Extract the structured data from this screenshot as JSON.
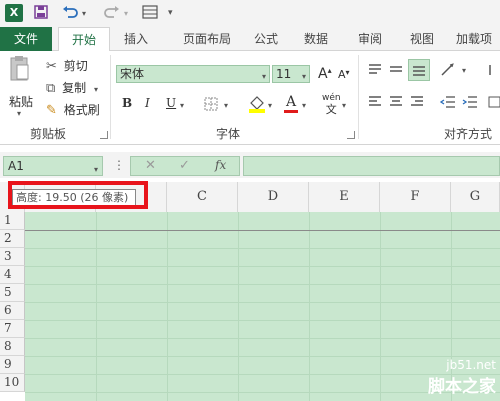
{
  "qat": {
    "excel_badge": "X",
    "save_icon": "save-icon",
    "undo_icon": "undo-icon",
    "redo_icon": "redo-icon",
    "customize_icon": "customize-icon"
  },
  "tabs": [
    {
      "label": "文件"
    },
    {
      "label": "开始"
    },
    {
      "label": "插入"
    },
    {
      "label": "页面布局"
    },
    {
      "label": "公式"
    },
    {
      "label": "数据"
    },
    {
      "label": "审阅"
    },
    {
      "label": "视图"
    },
    {
      "label": "加载项"
    }
  ],
  "ribbon": {
    "clipboard": {
      "paste": "粘贴",
      "cut": "剪切",
      "copy": "复制",
      "format_painter": "格式刷",
      "group_label": "剪贴板"
    },
    "font": {
      "font_name": "宋体",
      "font_size": "11",
      "bold": "B",
      "italic": "I",
      "underline": "U",
      "grow": "A",
      "shrink": "A",
      "font_color_letter": "A",
      "phonetic_top": "wén",
      "phonetic_bottom": "文",
      "group_label": "字体"
    },
    "alignment": {
      "group_label": "对齐方式"
    }
  },
  "formula_bar": {
    "name_box": "A1",
    "cancel": "✕",
    "enter": "✓",
    "fx": "fx"
  },
  "columns": [
    "C",
    "D",
    "E",
    "F",
    "G"
  ],
  "rows": [
    "1",
    "2",
    "3",
    "4",
    "5",
    "6",
    "7",
    "8",
    "9",
    "10"
  ],
  "tooltip": "高度: 19.50 (26 像素)",
  "watermark": {
    "site": "jb51.net",
    "brand": "脚本之家"
  },
  "colors": {
    "excel_green": "#207245",
    "selection_fill": "#c9e7cf",
    "annotation_red": "#e8141b"
  }
}
